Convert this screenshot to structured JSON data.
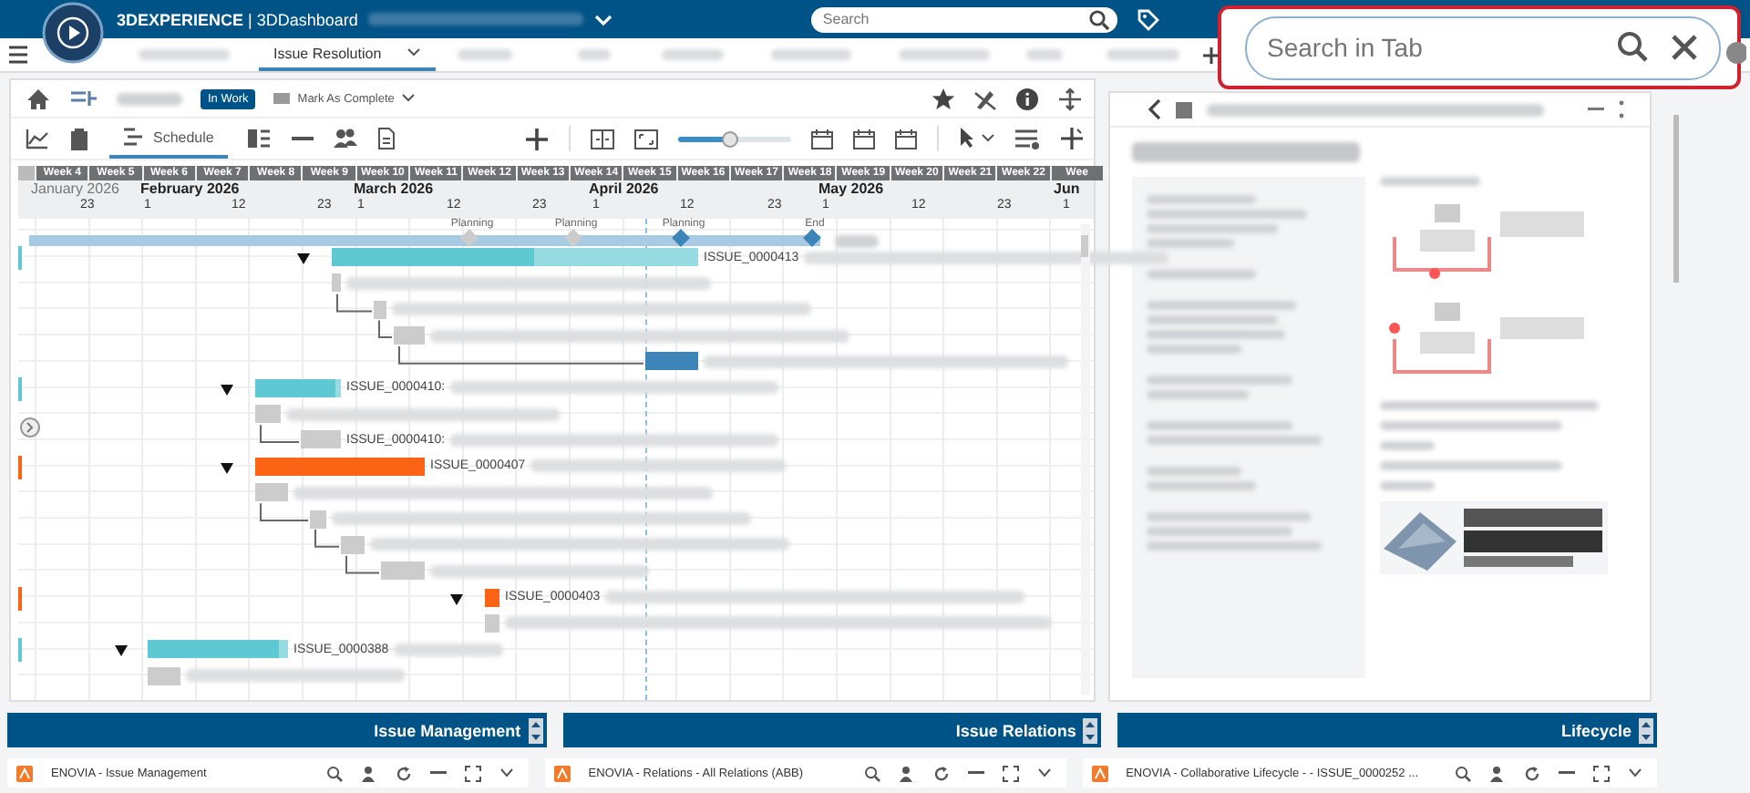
{
  "app_bar": {
    "title": "**3DEXPERIENCE** | 3DDashboard",
    "search": {
      "placeholder": "Search"
    }
  },
  "tabs": [
    {
      "label": "Issue Resolution",
      "selected": true
    }
  ],
  "tab_search": {
    "placeholder": "Search in Tab"
  },
  "issue_header": {
    "status": "In Work",
    "action": "Mark As Complete"
  },
  "view_tabs": [
    {
      "label": "Schedule",
      "selected": true
    }
  ],
  "zoom_slider": {
    "level": 0.47
  },
  "gantt": {
    "weeks": [
      "Week 4",
      "Week 5",
      "Week 6",
      "Week 7",
      "Week 8",
      "Week 9",
      "Week 10",
      "Week 11",
      "Week 12",
      "Week 13",
      "Week 14",
      "Week 15",
      "Week 16",
      "Week 17",
      "Week 18",
      "Week 19",
      "Week 20",
      "Week 21",
      "Week 22",
      "Wee"
    ],
    "months": [
      "January 2026",
      "February 2026",
      "March 2026",
      "April 2026",
      "May 2026",
      "Jun"
    ],
    "days": [
      "23",
      "1",
      "12",
      "23",
      "1",
      "12",
      "23",
      "1",
      "12",
      "23",
      "1",
      "12",
      "23",
      "1"
    ],
    "milestones": [
      {
        "label": "Planning",
        "color": "#cccccc"
      },
      {
        "label": "Planning",
        "color": "#cccccc"
      },
      {
        "label": "Planning",
        "color": "#3d85b8"
      },
      {
        "label": "End",
        "color": "#3d85b8"
      }
    ],
    "rows": [
      {
        "kind": "summary",
        "label": "ISSUE_0000413",
        "color": "#5ec9d3",
        "level": 0.55,
        "expanded": true
      },
      {
        "kind": "task",
        "color": "#cccccc"
      },
      {
        "kind": "task",
        "color": "#cccccc"
      },
      {
        "kind": "task",
        "color": "#cccccc"
      },
      {
        "kind": "task",
        "color": "#3d85b8"
      },
      {
        "kind": "summary",
        "label": "ISSUE_0000410:",
        "color": "#5ec9d3",
        "level": 0.94,
        "expanded": true
      },
      {
        "kind": "task",
        "color": "#cccccc"
      },
      {
        "kind": "task",
        "label": "ISSUE_0000410:",
        "color": "#cccccc"
      },
      {
        "kind": "summary",
        "label": "ISSUE_0000407",
        "color": "#fa6414",
        "expanded": true
      },
      {
        "kind": "task",
        "color": "#cccccc"
      },
      {
        "kind": "task",
        "color": "#cccccc"
      },
      {
        "kind": "task",
        "color": "#cccccc"
      },
      {
        "kind": "task",
        "color": "#cccccc"
      },
      {
        "kind": "summary",
        "label": "ISSUE_0000403",
        "color": "#fa6414",
        "expanded": true
      },
      {
        "kind": "task",
        "color": "#cccccc"
      },
      {
        "kind": "summary",
        "label": "ISSUE_0000388",
        "color": "#5ec9d3",
        "level": 0.93,
        "expanded": true
      },
      {
        "kind": "task",
        "color": "#cccccc"
      }
    ]
  },
  "panels": [
    {
      "title": "Issue Management"
    },
    {
      "title": "Issue Relations"
    },
    {
      "title": "Lifecycle"
    }
  ],
  "widgets": [
    {
      "title": "ENOVIA - Issue Management"
    },
    {
      "title": "ENOVIA - Relations - All Relations (ABB)"
    },
    {
      "title": "ENOVIA - Collaborative Lifecycle - - ISSUE_0000252 ..."
    }
  ]
}
